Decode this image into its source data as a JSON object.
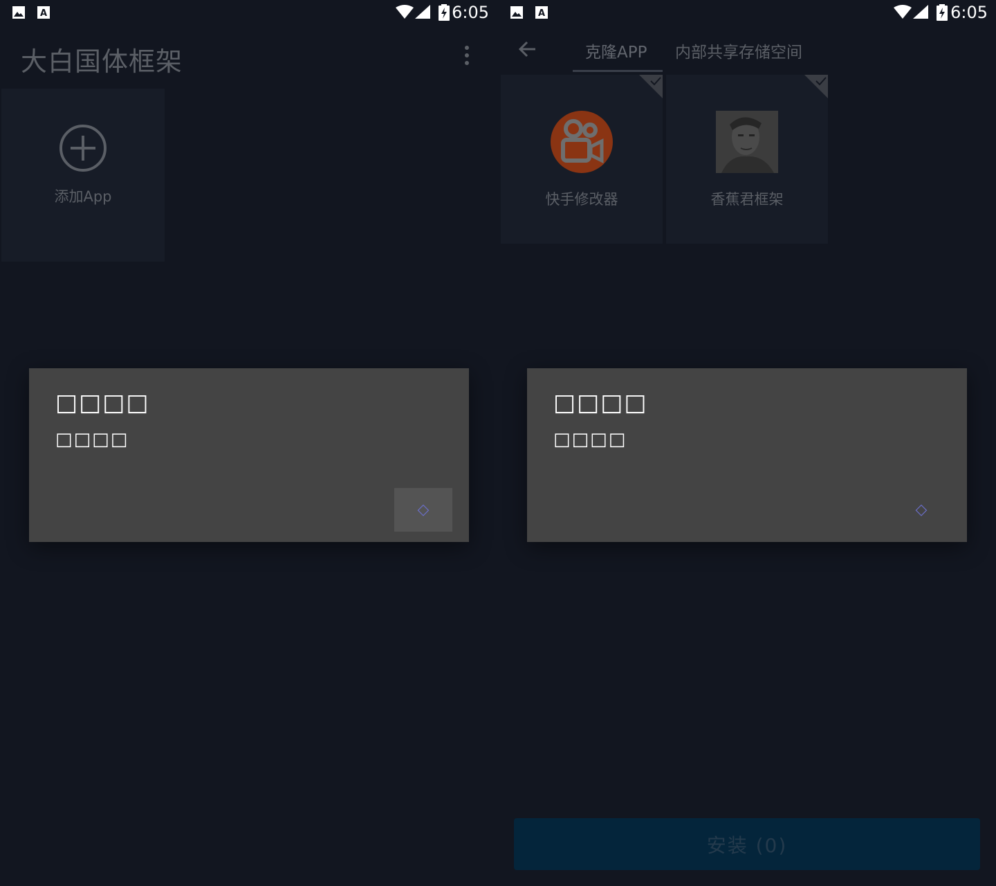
{
  "status_bar": {
    "time": "6:05"
  },
  "left_screen": {
    "app_title": "大白国体框架",
    "add_tile": {
      "label": "添加App",
      "icon": "add-circle-icon"
    },
    "dialog": {
      "title": "□□□□",
      "message": "□□□□",
      "button_glyph": "◇"
    }
  },
  "right_screen": {
    "tabs": [
      {
        "label": "克隆APP",
        "selected": true
      },
      {
        "label": "内部共享存储空间",
        "selected": false
      }
    ],
    "apps": [
      {
        "name": "快手修改器",
        "icon": "kuaishou-camera-icon",
        "checked": true
      },
      {
        "name": "香蕉君框架",
        "icon": "portrait-photo-icon",
        "checked": true
      }
    ],
    "dialog": {
      "title": "□□□□",
      "message": "□□□□",
      "button_glyph": "◇"
    },
    "install_button": "安装 (0)"
  },
  "colors": {
    "background": "#121620",
    "dialog": "#444444",
    "install_button": "#04253b",
    "kuaishou_orange": "#8a3413"
  }
}
